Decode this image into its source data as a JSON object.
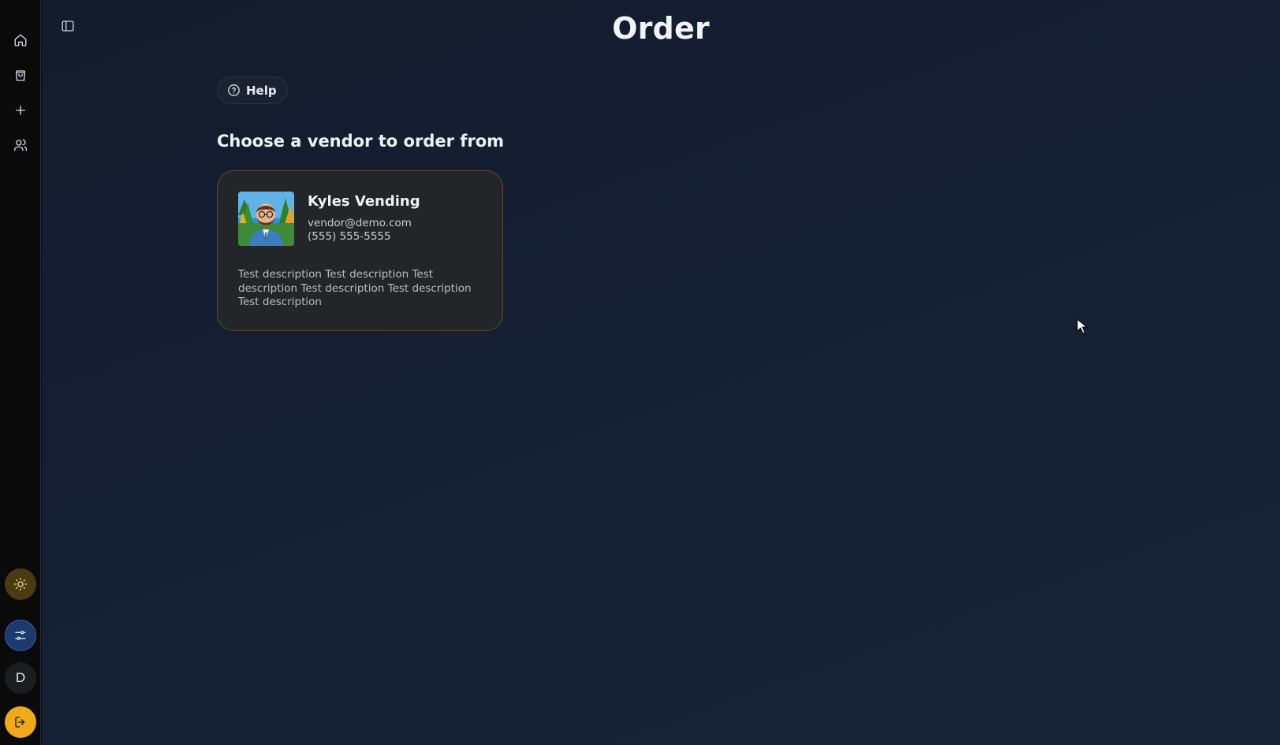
{
  "page": {
    "title": "Order"
  },
  "sidebar": {
    "nav": [
      {
        "name": "home",
        "icon": "home-icon"
      },
      {
        "name": "orders",
        "icon": "shopping-bag-icon"
      },
      {
        "name": "new",
        "icon": "plus-icon"
      },
      {
        "name": "users",
        "icon": "users-icon"
      }
    ],
    "bottom": {
      "theme_icon": "sun-icon",
      "filter_icon": "sliders-icon",
      "avatar_letter": "D",
      "logout_icon": "logout-icon"
    }
  },
  "help": {
    "label": "Help"
  },
  "section": {
    "heading": "Choose a vendor to order from"
  },
  "vendor": {
    "name": "Kyles Vending",
    "email": "vendor@demo.com",
    "phone": "(555) 555-5555",
    "description": "Test description Test description Test description Test description Test description Test description"
  },
  "colors": {
    "accent": "#f0a81c",
    "card_border": "#5b4a2c",
    "filter_button": "#1c3a6e"
  }
}
